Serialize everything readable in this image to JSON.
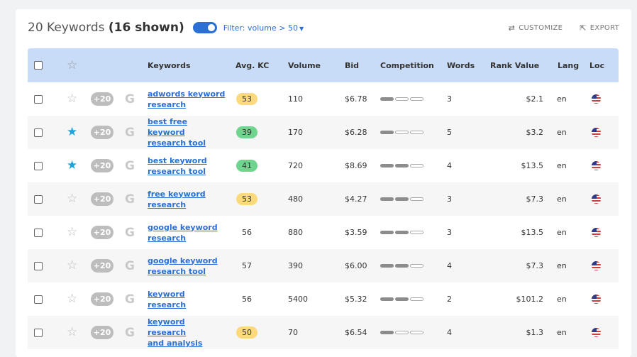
{
  "header": {
    "title_count": "20 Keywords",
    "title_shown": "(16 shown)",
    "filter_label": "Filter: volume > 50",
    "customize_label": "CUSTOMIZE",
    "export_label": "EXPORT"
  },
  "columns": {
    "keywords": "Keywords",
    "avg_kc": "Avg. KC",
    "volume": "Volume",
    "bid": "Bid",
    "competition": "Competition",
    "words": "Words",
    "rank_value": "Rank Value",
    "lang": "Lang",
    "loc": "Loc"
  },
  "rows": [
    {
      "starred": false,
      "plus": "+20",
      "keyword_line1": "adwords keyword",
      "keyword_line2": "research",
      "kc": "53",
      "kc_color": "yellow",
      "volume": "110",
      "bid": "$6.78",
      "competition_level": 1,
      "words": "3",
      "rank_value": "$2.1",
      "lang": "en"
    },
    {
      "starred": true,
      "plus": "+20",
      "keyword_line1": "best free keyword",
      "keyword_line2": "research tool",
      "kc": "39",
      "kc_color": "green",
      "volume": "170",
      "bid": "$6.28",
      "competition_level": 1,
      "words": "5",
      "rank_value": "$3.2",
      "lang": "en"
    },
    {
      "starred": true,
      "plus": "+20",
      "keyword_line1": "best keyword",
      "keyword_line2": "research tool",
      "kc": "41",
      "kc_color": "green",
      "volume": "720",
      "bid": "$8.69",
      "competition_level": 2,
      "words": "4",
      "rank_value": "$13.5",
      "lang": "en"
    },
    {
      "starred": false,
      "plus": "+20",
      "keyword_line1": "free keyword",
      "keyword_line2": "research",
      "kc": "53",
      "kc_color": "yellow",
      "volume": "480",
      "bid": "$4.27",
      "competition_level": 2,
      "words": "3",
      "rank_value": "$7.3",
      "lang": "en"
    },
    {
      "starred": false,
      "plus": "+20",
      "keyword_line1": "google keyword",
      "keyword_line2": "research",
      "kc": "56",
      "kc_color": "none",
      "volume": "880",
      "bid": "$3.59",
      "competition_level": 2,
      "words": "3",
      "rank_value": "$13.5",
      "lang": "en"
    },
    {
      "starred": false,
      "plus": "+20",
      "keyword_line1": "google keyword",
      "keyword_line2": "research tool",
      "kc": "57",
      "kc_color": "none",
      "volume": "390",
      "bid": "$6.00",
      "competition_level": 2,
      "words": "4",
      "rank_value": "$7.3",
      "lang": "en"
    },
    {
      "starred": false,
      "plus": "+20",
      "keyword_line1": "keyword research",
      "keyword_line2": "",
      "kc": "56",
      "kc_color": "none",
      "volume": "5400",
      "bid": "$5.32",
      "competition_level": 2,
      "words": "2",
      "rank_value": "$101.2",
      "lang": "en"
    },
    {
      "starred": false,
      "plus": "+20",
      "keyword_line1": "keyword research",
      "keyword_line2": "and analysis",
      "kc": "50",
      "kc_color": "yellow",
      "volume": "70",
      "bid": "$6.54",
      "competition_level": 1,
      "words": "4",
      "rank_value": "$1.3",
      "lang": "en"
    }
  ],
  "colors": {
    "accent": "#2b6fd6",
    "header_bg": "#c8dcf7",
    "star_active": "#1ba3dd",
    "kc_yellow": "#fcd97a",
    "kc_green": "#6fd58e"
  },
  "icons": {
    "header_star": "star-outline-icon",
    "google": "google-icon",
    "flag": "us-flag-icon",
    "customize": "sliders-icon",
    "export": "export-icon"
  }
}
